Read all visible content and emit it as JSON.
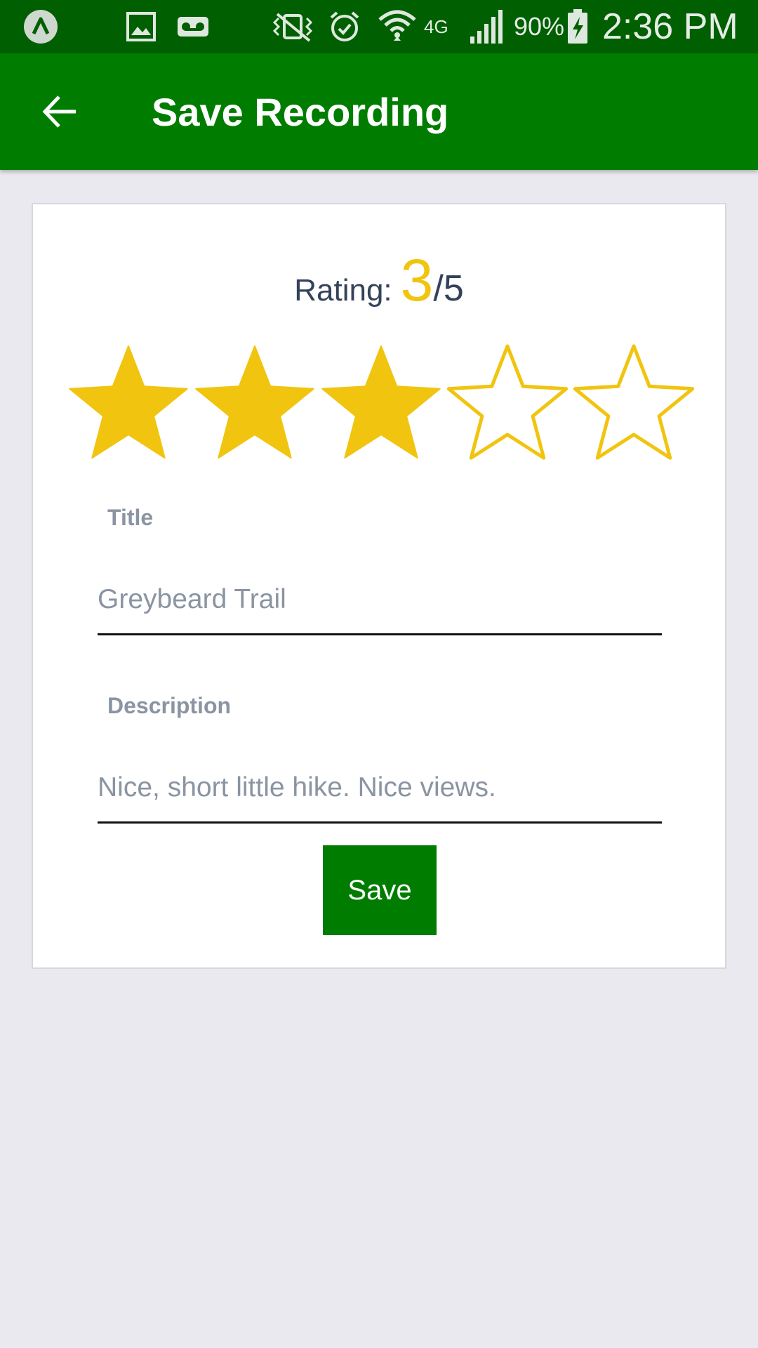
{
  "status_bar": {
    "battery": "90%",
    "time": "2:36 PM",
    "network_type": "4G",
    "icons": [
      "app-notification-icon",
      "image-icon",
      "voicemail-icon",
      "vibrate-icon",
      "alarm-icon",
      "wifi-icon",
      "cell-signal-icon",
      "battery-charging-icon"
    ]
  },
  "app_bar": {
    "title": "Save Recording",
    "back_icon": "arrow-left-icon",
    "color": "#007d00"
  },
  "rating": {
    "label": "Rating:",
    "value": "3",
    "max": "/5",
    "filled_stars": 3,
    "total_stars": 5,
    "star_color": "#f1c40f"
  },
  "form": {
    "title_label": "Title",
    "title_value": "Greybeard Trail",
    "description_label": "Description",
    "description_value": "Nice, short little hike. Nice views.",
    "save_label": "Save"
  }
}
